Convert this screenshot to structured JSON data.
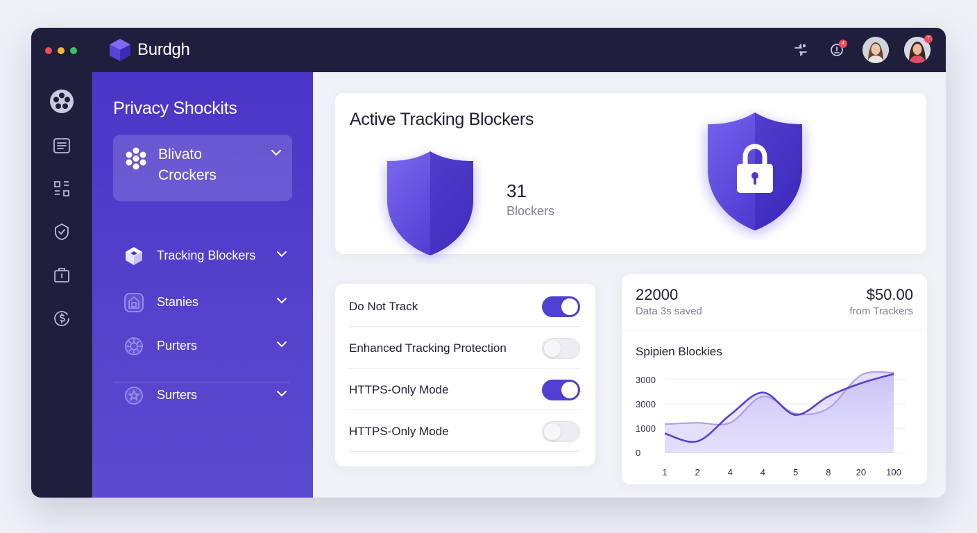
{
  "app": {
    "name": "Burdgh"
  },
  "colors": {
    "accent": "#5140d4",
    "sidebar": "#4b35c8",
    "titlebar": "#1f1f3d",
    "badge": "#ef4b5b"
  },
  "window_controls": [
    {
      "name": "close",
      "color": "#ef4b5b"
    },
    {
      "name": "minimize",
      "color": "#f5b92e"
    },
    {
      "name": "maximize",
      "color": "#3cc45f"
    }
  ],
  "topbar": {
    "icons": [
      {
        "icon": "connection-icon",
        "badge": ""
      },
      {
        "icon": "notification-icon",
        "badge": "4"
      }
    ],
    "avatars": [
      {
        "icon": "user-avatar",
        "badge": ""
      },
      {
        "icon": "user-avatar",
        "badge": "7"
      }
    ]
  },
  "rail": {
    "icons": [
      "film-reel-icon",
      "document-icon",
      "grid-icon",
      "shield-check-icon",
      "briefcase-icon",
      "dollar-cycle-icon"
    ]
  },
  "sidebar": {
    "title": "Privacy Shockits",
    "active": {
      "label": "Blivato Crockers",
      "icon": "hexagon-cluster-icon"
    },
    "items": [
      {
        "label": "Tracking Blockers",
        "icon": "cube-icon"
      },
      {
        "label": "Stanies",
        "icon": "house-lock-icon"
      },
      {
        "label": "Purters",
        "icon": "gear-cog-icon"
      },
      {
        "label": "Surters",
        "icon": "badge-star-icon"
      }
    ]
  },
  "hero": {
    "title": "Active Tracking Blockers",
    "count": "31",
    "count_label": "Blockers"
  },
  "toggles": [
    {
      "label": "Do Not Track",
      "on": true
    },
    {
      "label": "Enhanced Tracking Protection",
      "on": false
    },
    {
      "label": "HTTPS-Only Mode",
      "on": true
    },
    {
      "label": "HTTPS-Only Mode",
      "on": false
    }
  ],
  "stats": {
    "left_value": "22000",
    "left_label": "Data 3s saved",
    "right_value": "$50.00",
    "right_label": "from Trackers"
  },
  "chart_data": {
    "type": "area",
    "title": "Spipien Blockies",
    "categories": [
      "1",
      "2",
      "4",
      "4",
      "5",
      "8",
      "20",
      "100"
    ],
    "y_tick_labels": [
      "3000",
      "3000",
      "1000",
      "0"
    ],
    "series": [
      {
        "values": [
          750,
          450,
          1450,
          2300,
          1450,
          2150,
          2650,
          3000
        ]
      },
      {
        "values": [
          1100,
          1150,
          1150,
          2150,
          1500,
          1700,
          2950,
          3050
        ]
      }
    ]
  }
}
